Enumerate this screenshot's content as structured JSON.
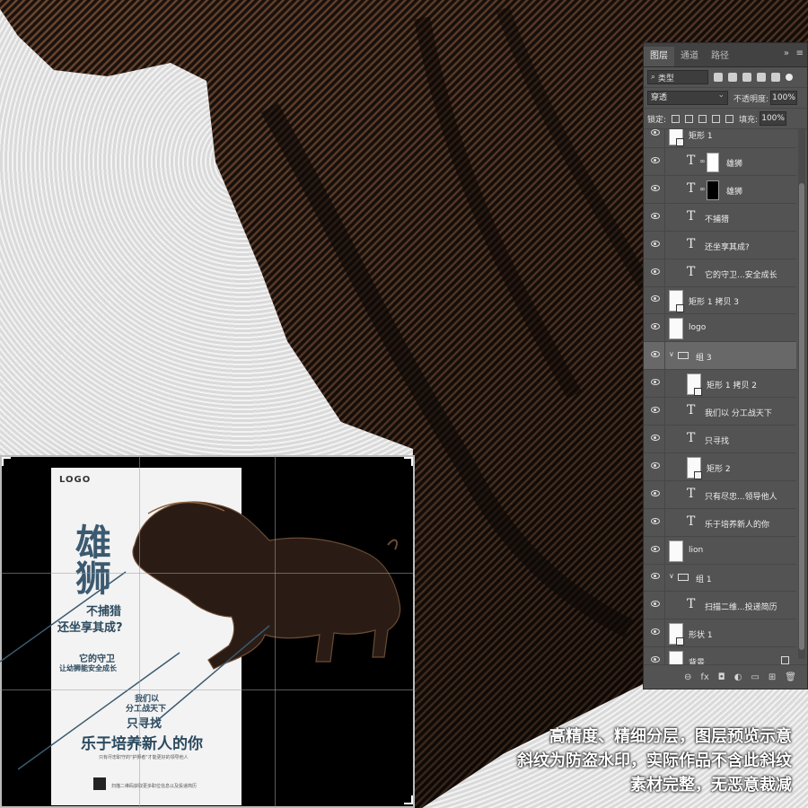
{
  "panel": {
    "tabs": [
      "图层",
      "通道",
      "路径"
    ],
    "filter_kind": "类型",
    "blend_mode": "穿透",
    "opacity_label": "不透明度:",
    "opacity_value": "100%",
    "lock_label": "锁定:",
    "fill_label": "填充:",
    "fill_value": "100%",
    "layers": [
      {
        "name": "矩形 1",
        "kind": "shape",
        "indent": 0
      },
      {
        "name": "雄狮",
        "kind": "text-mask-white",
        "indent": 1
      },
      {
        "name": "雄狮",
        "kind": "text-mask-black",
        "indent": 1
      },
      {
        "name": "不捕猎",
        "kind": "text",
        "indent": 1
      },
      {
        "name": "还坐享其成?",
        "kind": "text",
        "indent": 1
      },
      {
        "name": "它的守卫...安全成长",
        "kind": "text",
        "indent": 1
      },
      {
        "name": "矩形 1 拷贝 3",
        "kind": "shape",
        "indent": 0
      },
      {
        "name": "logo",
        "kind": "image",
        "indent": 0
      },
      {
        "name": "组 3",
        "kind": "group",
        "indent": 0,
        "selected": true
      },
      {
        "name": "矩形 1 拷贝 2",
        "kind": "shape",
        "indent": 1
      },
      {
        "name": "我们以 分工战天下",
        "kind": "text",
        "indent": 1
      },
      {
        "name": "只寻找",
        "kind": "text",
        "indent": 1
      },
      {
        "name": "矩形 2",
        "kind": "shape",
        "indent": 1
      },
      {
        "name": "只有尽忠...领导他人",
        "kind": "text",
        "indent": 1
      },
      {
        "name": "乐于培养新人的你",
        "kind": "text",
        "indent": 1
      },
      {
        "name": "lion",
        "kind": "image",
        "indent": 0
      },
      {
        "name": "组 1",
        "kind": "group",
        "indent": 0
      },
      {
        "name": "扫描二维...投递简历",
        "kind": "text",
        "indent": 1
      },
      {
        "name": "形状 1",
        "kind": "shape",
        "indent": 0
      },
      {
        "name": "背景",
        "kind": "background",
        "indent": 0,
        "locked": true
      }
    ],
    "bottom_icons": [
      "link-icon",
      "fx-icon",
      "mask-icon",
      "adjustment-icon",
      "folder-icon",
      "new-layer-icon",
      "trash-icon"
    ]
  },
  "poster": {
    "logo": "LOGO",
    "title_line1": "雄",
    "title_line2": "狮",
    "line_a": "不捕猎",
    "line_b": "还坐享其成?",
    "line_c": "它的守卫",
    "line_d": "让幼狮能安全成长",
    "line_e": "我们以",
    "line_f": "分工战天下",
    "line_g": "只寻找",
    "line_h": "乐于培养新人的你",
    "line_i": "只有尽忠职守的\"护狮者\"才能更好的领导他人",
    "line_j": "扫描二维码获取更多职位信息以及投递简历"
  },
  "captions": {
    "line1": "高精度、精细分层，图层预览示意",
    "line2": "斜纹为防盗水印，实际作品不含此斜纹",
    "line3": "素材完整，无恶意裁减"
  },
  "colors": {
    "accent": "#3b5a70",
    "panel": "#535353",
    "art": "#3a2418"
  }
}
